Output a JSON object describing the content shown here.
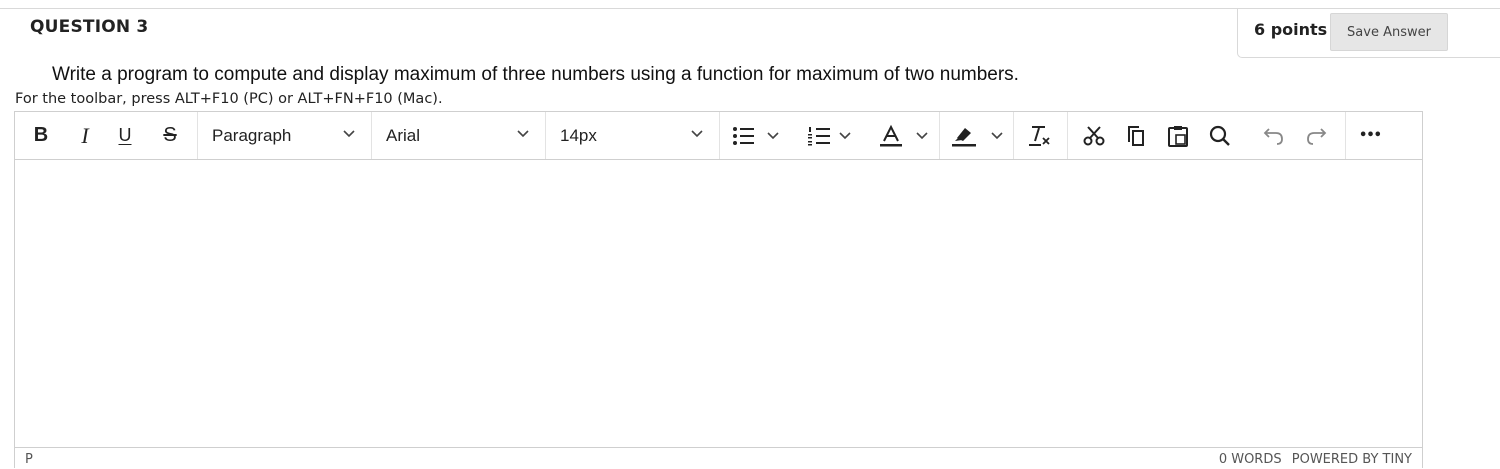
{
  "question": {
    "title": "QUESTION 3",
    "points": "6 points",
    "save_label": "Save Answer",
    "text": "Write a program to compute and display maximum of three numbers using a function for maximum of two numbers."
  },
  "editor": {
    "toolbar_hint": "For the toolbar, press ALT+F10 (PC) or ALT+FN+F10 (Mac).",
    "block_format": "Paragraph",
    "font_family": "Arial",
    "font_size": "14px",
    "bold_label": "B",
    "italic_label": "I",
    "underline_label": "U",
    "strike_label": "S",
    "more_label": "•••",
    "content": "",
    "path": "P",
    "word_count": "0 WORDS",
    "powered_by": "POWERED BY TINY"
  },
  "icons": [
    "bold-icon",
    "italic-icon",
    "underline-icon",
    "strikethrough-icon",
    "bullet-list-icon",
    "numbered-list-icon",
    "text-color-icon",
    "highlight-icon",
    "clear-format-icon",
    "cut-icon",
    "copy-icon",
    "paste-icon",
    "find-icon",
    "undo-icon",
    "redo-icon",
    "more-icon"
  ]
}
